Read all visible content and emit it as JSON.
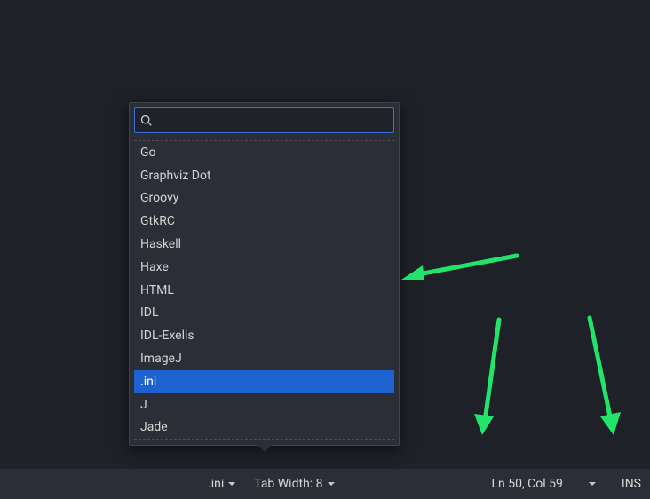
{
  "popover": {
    "search_placeholder": "",
    "items": [
      {
        "label": "Go",
        "selected": false
      },
      {
        "label": "Graphviz Dot",
        "selected": false
      },
      {
        "label": "Groovy",
        "selected": false
      },
      {
        "label": "GtkRC",
        "selected": false
      },
      {
        "label": "Haskell",
        "selected": false
      },
      {
        "label": "Haxe",
        "selected": false
      },
      {
        "label": "HTML",
        "selected": false
      },
      {
        "label": "IDL",
        "selected": false
      },
      {
        "label": "IDL-Exelis",
        "selected": false
      },
      {
        "label": "ImageJ",
        "selected": false
      },
      {
        "label": ".ini",
        "selected": true
      },
      {
        "label": "J",
        "selected": false
      },
      {
        "label": "Jade",
        "selected": false
      }
    ]
  },
  "statusbar": {
    "language": ".ini",
    "tabwidth": "Tab Width: 8",
    "cursor": "Ln 50, Col 59",
    "insertmode": "INS"
  }
}
